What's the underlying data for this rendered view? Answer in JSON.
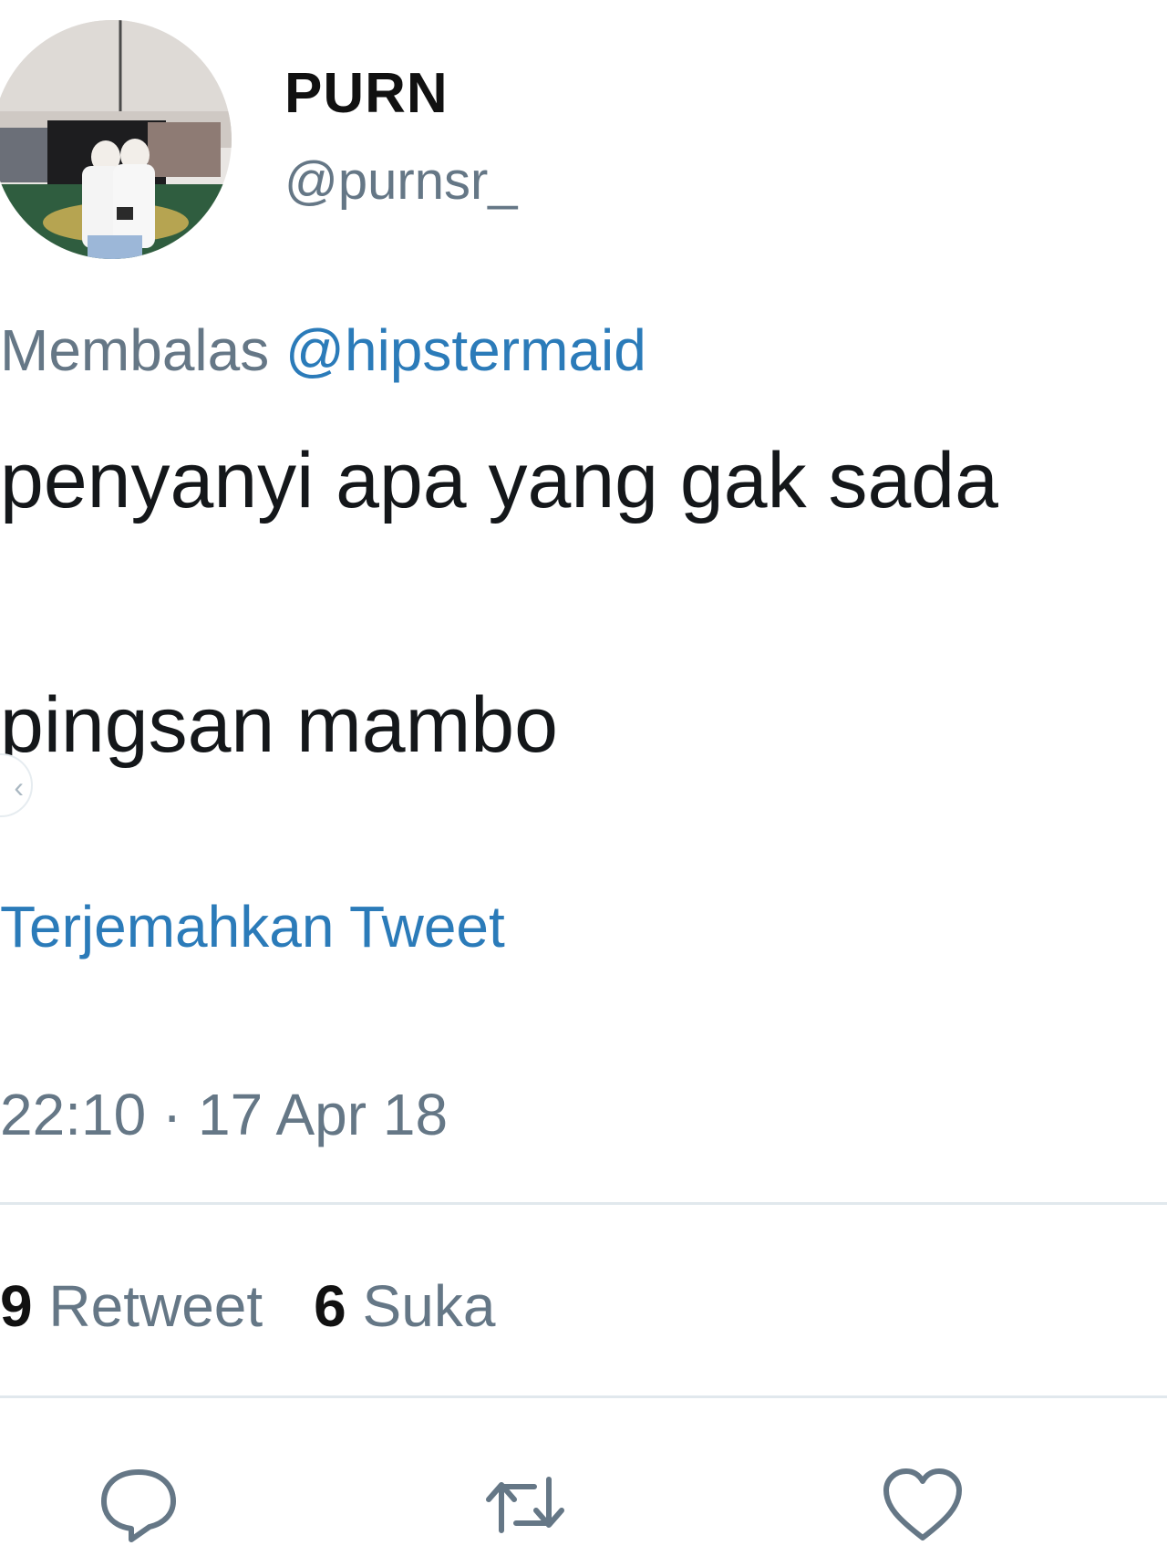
{
  "tweet": {
    "display_name": "PURN",
    "handle": "@purnsr_",
    "reply_prefix": "Membalas",
    "reply_to": "@hipstermaid",
    "text_line_1": "penyanyi apa yang gak sada",
    "text_line_2": "pingsan mambo",
    "translate_link": "Terjemahkan Tweet",
    "timestamp": "22:10 · 17 Apr 18"
  },
  "stats": {
    "retweets_count": "9",
    "retweets_label": "Retweet",
    "likes_count": "6",
    "likes_label": "Suka"
  },
  "actions": {
    "reply_icon": "reply-icon",
    "retweet_icon": "retweet-icon",
    "like_icon": "heart-icon"
  },
  "colors": {
    "link": "#2b7bb9",
    "secondary_text": "#657786",
    "primary_text": "#14171a",
    "divider": "#e1e8ed"
  }
}
